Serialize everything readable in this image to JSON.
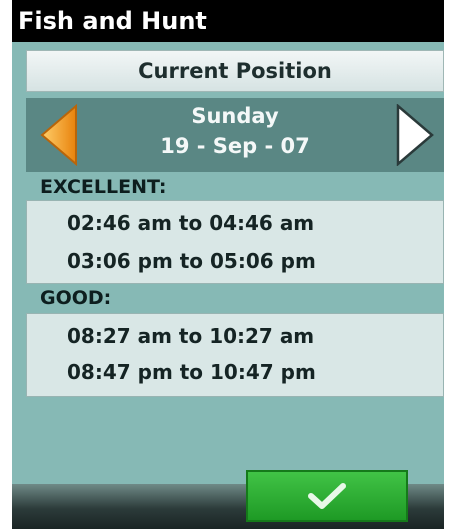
{
  "title": "Fish and Hunt",
  "position_button": "Current Position",
  "date": {
    "day": "Sunday",
    "full": "19 - Sep - 07"
  },
  "excellent": {
    "label": "EXCELLENT:",
    "times": [
      "02:46  am to 04:46  am",
      "03:06  pm to 05:06  pm"
    ]
  },
  "good": {
    "label": "GOOD:",
    "times": [
      "08:27  am to 10:27  am",
      "08:47  pm to 10:47  pm"
    ]
  },
  "icons": {
    "prev": "left-arrow-icon",
    "next": "right-arrow-icon",
    "ok": "checkmark-icon"
  },
  "colors": {
    "background": "#86b9b5",
    "titlebar": "#000000",
    "prev_arrow": "#f39a1e",
    "next_arrow": "#ffffff",
    "ok_button": "#2aa830"
  }
}
